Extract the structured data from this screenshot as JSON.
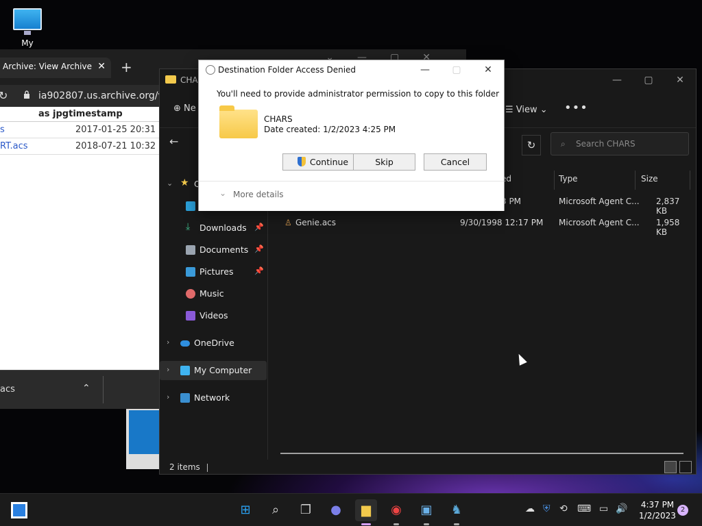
{
  "desktop": {
    "icon_label": "My Computer"
  },
  "browser": {
    "tab_title": "Archive: View Archive",
    "url": "ia902807.us.archive.org/view",
    "column_header": "as jpgtimestamp",
    "rows": [
      {
        "name": "s",
        "date": "2017-01-25 20:31"
      },
      {
        "name": "RT.acs",
        "date": "2018-07-21 10:32"
      }
    ],
    "download_file": "acs"
  },
  "explorer": {
    "title": "CHAR",
    "new_label": "Ne",
    "view_label": "View",
    "search_placeholder": "Search CHARS",
    "sidebar": {
      "quick_access_partial": "Q",
      "downloads": "Downloads",
      "documents": "Documents",
      "pictures": "Pictures",
      "music": "Music",
      "videos": "Videos",
      "onedrive": "OneDrive",
      "my_computer": "My Computer",
      "network": "Network"
    },
    "columns": {
      "modified_partial": "ed",
      "type": "Type",
      "size": "Size"
    },
    "files": [
      {
        "name": "",
        "modified": "3 PM",
        "type": "Microsoft Agent C...",
        "size": "2,837 KB"
      },
      {
        "name": "Genie.acs",
        "modified": "9/30/1998 12:17 PM",
        "type": "Microsoft Agent C...",
        "size": "1,958 KB"
      }
    ],
    "status": "2 items"
  },
  "dialog": {
    "title": "Destination Folder Access Denied",
    "message": "You'll need to provide administrator permission to copy to this folder",
    "folder_name": "CHARS",
    "folder_date": "Date created: 1/2/2023 4:25 PM",
    "continue_label": "Continue",
    "skip_label": "Skip",
    "cancel_label": "Cancel",
    "more_details": "More details"
  },
  "taskbar": {
    "time": "4:37 PM",
    "date": "1/2/2023",
    "notifications": "2"
  }
}
